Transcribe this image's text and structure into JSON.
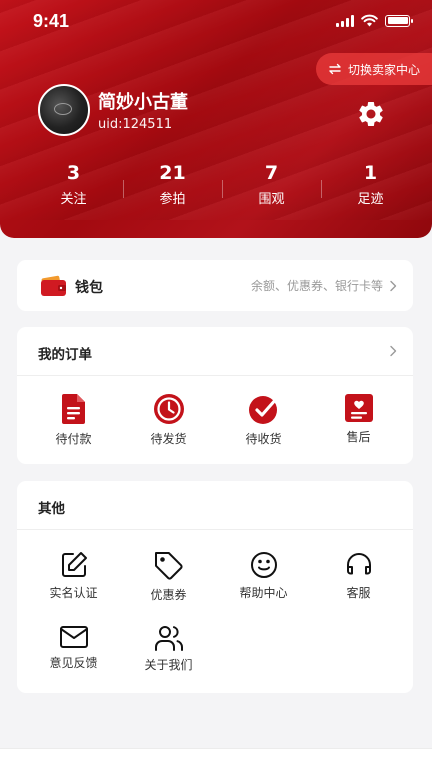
{
  "status_bar": {
    "time": "9:41"
  },
  "header": {
    "switch_button_label": "切换卖家中心",
    "username": "简妙小古董",
    "uid": "uid:124511",
    "stats": [
      {
        "value": "3",
        "label": "关注"
      },
      {
        "value": "21",
        "label": "参拍"
      },
      {
        "value": "7",
        "label": "围观"
      },
      {
        "value": "1",
        "label": "足迹"
      }
    ]
  },
  "wallet": {
    "title": "钱包",
    "hint": "余额、优惠券、银行卡等"
  },
  "orders": {
    "title": "我的订单",
    "items": [
      {
        "label": "待付款",
        "icon": "document-icon"
      },
      {
        "label": "待发货",
        "icon": "clock-icon"
      },
      {
        "label": "待收货",
        "icon": "check-circle-icon"
      },
      {
        "label": "售后",
        "icon": "heart-card-icon"
      }
    ]
  },
  "others": {
    "title": "其他",
    "items": [
      {
        "label": "实名认证",
        "icon": "edit-icon"
      },
      {
        "label": "优惠券",
        "icon": "tag-icon"
      },
      {
        "label": "帮助中心",
        "icon": "smile-icon"
      },
      {
        "label": "客服",
        "icon": "headphones-icon"
      },
      {
        "label": "意见反馈",
        "icon": "mail-icon"
      },
      {
        "label": "关于我们",
        "icon": "users-icon"
      }
    ]
  },
  "colors": {
    "brand_red": "#b80f17",
    "icon_red": "#c3121a",
    "background": "#f4f4f6"
  }
}
